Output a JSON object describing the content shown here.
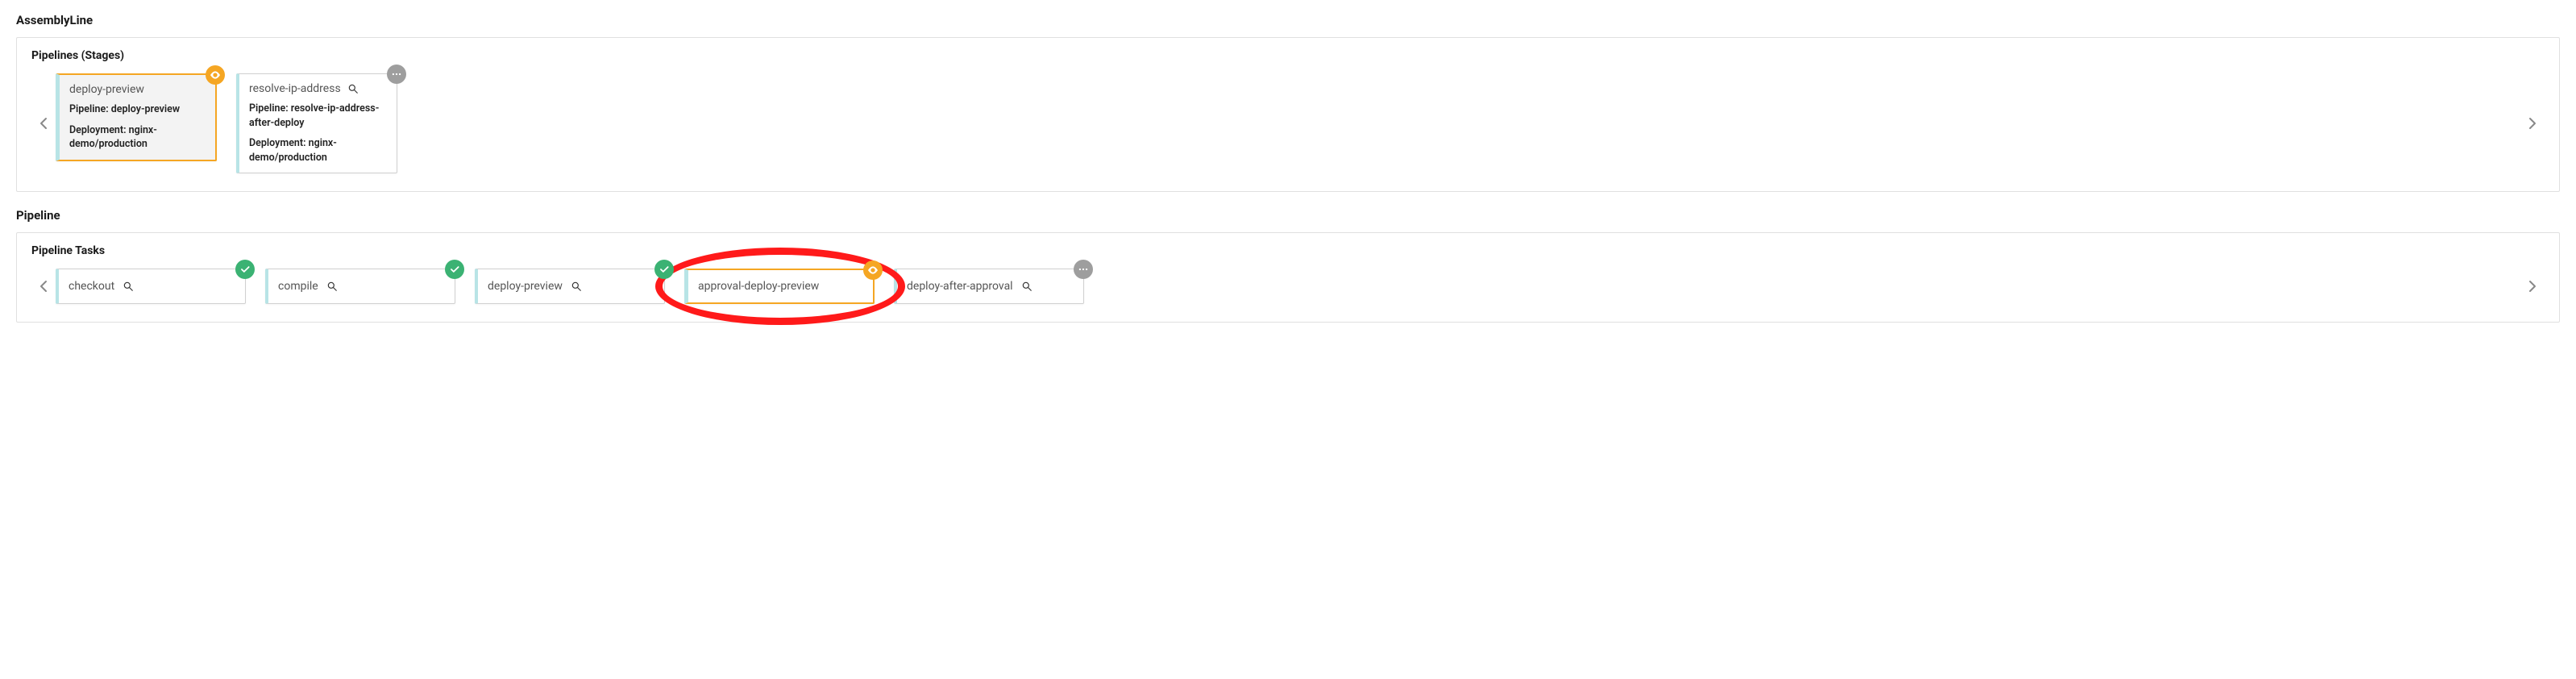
{
  "sections": {
    "assemblyLine": {
      "title": "AssemblyLine",
      "panelTitle": "Pipelines (Stages)",
      "stages": [
        {
          "name": "deploy-preview",
          "pipelineLabel": "Pipeline: deploy-preview",
          "deploymentLabel": "Deployment: nginx-demo/production",
          "status": "orange-eye",
          "selected": true,
          "hasMagnifier": false
        },
        {
          "name": "resolve-ip-address",
          "pipelineLabel": "Pipeline: resolve-ip-address-after-deploy",
          "deploymentLabel": "Deployment: nginx-demo/production",
          "status": "grey-dots",
          "selected": false,
          "hasMagnifier": true
        }
      ]
    },
    "pipeline": {
      "title": "Pipeline",
      "panelTitle": "Pipeline Tasks",
      "tasks": [
        {
          "name": "checkout",
          "status": "green-check",
          "hasMagnifier": true,
          "selected": false,
          "highlighted": false
        },
        {
          "name": "compile",
          "status": "green-check",
          "hasMagnifier": true,
          "selected": false,
          "highlighted": false
        },
        {
          "name": "deploy-preview",
          "status": "green-check",
          "hasMagnifier": true,
          "selected": false,
          "highlighted": false
        },
        {
          "name": "approval-deploy-preview",
          "status": "orange-eye",
          "hasMagnifier": false,
          "selected": true,
          "highlighted": true
        },
        {
          "name": "deploy-after-approval",
          "status": "grey-dots",
          "hasMagnifier": true,
          "selected": false,
          "highlighted": false
        }
      ]
    }
  },
  "icons": {
    "eye": "eye-icon",
    "check": "check-icon",
    "dots": "dots-icon",
    "magnifier": "magnifier-icon",
    "chevronLeft": "chevron-left-icon",
    "chevronRight": "chevron-right-icon"
  },
  "colors": {
    "accentOrange": "#f5a623",
    "statusGreen": "#3bb273",
    "statusGrey": "#9e9e9e",
    "highlightRed": "#ff1a1a",
    "cardBorderAccent": "#b8e4e6"
  }
}
